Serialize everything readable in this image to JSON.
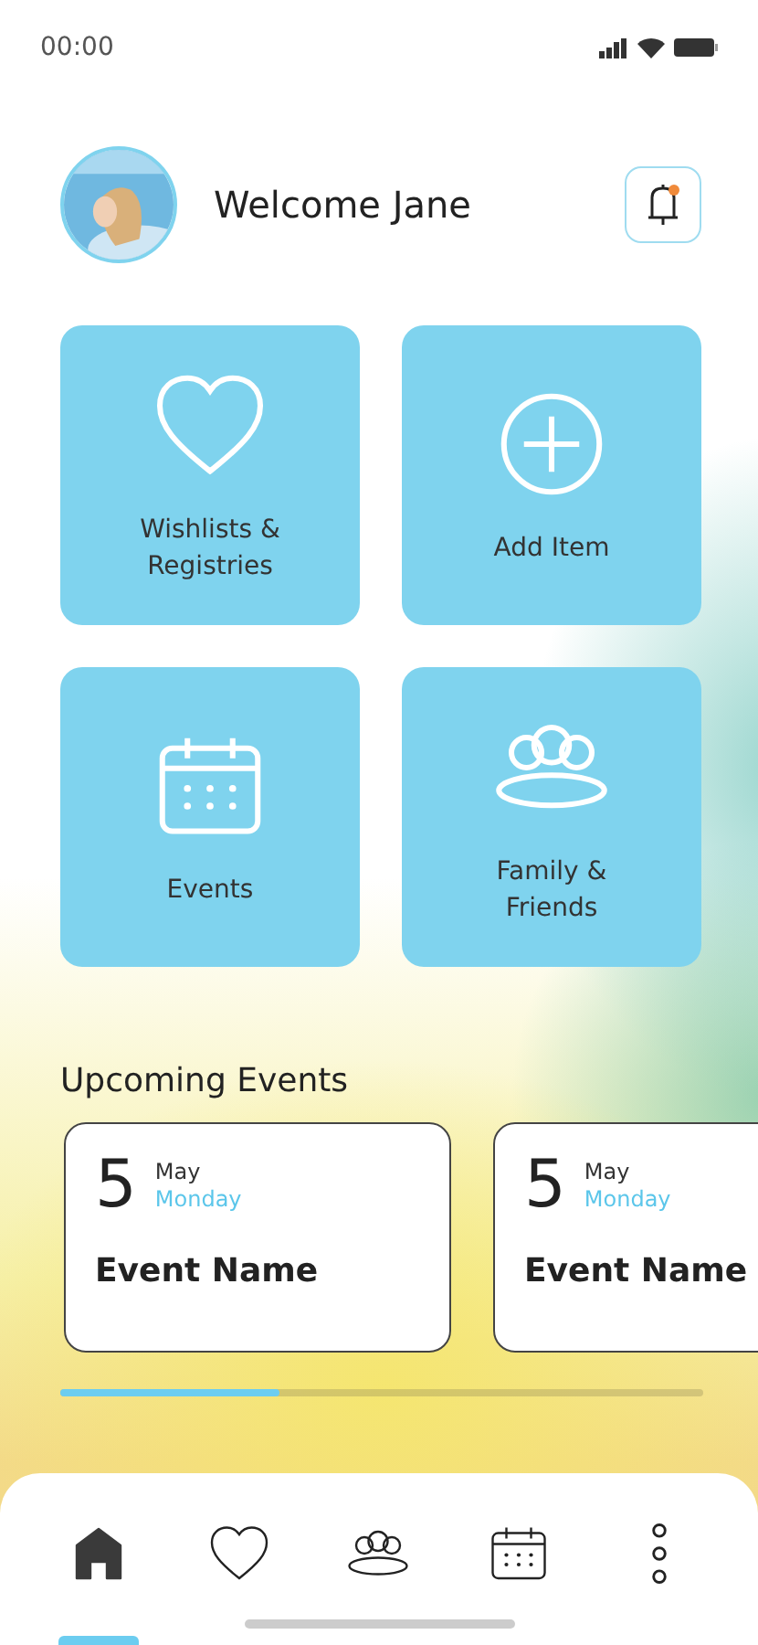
{
  "status_bar": {
    "time": "00:00"
  },
  "header": {
    "greeting": "Welcome Jane",
    "notification": {
      "unread": true
    }
  },
  "tiles": [
    {
      "kind": "heart",
      "label": "Wishlists & Registries"
    },
    {
      "kind": "plus",
      "label": "Add Item"
    },
    {
      "kind": "calendar",
      "label": "Events"
    },
    {
      "kind": "people",
      "label": "Family & Friends"
    }
  ],
  "upcoming": {
    "title": "Upcoming Events",
    "events": [
      {
        "day": "5",
        "month": "May",
        "weekday": "Monday",
        "name": "Event Name"
      },
      {
        "day": "5",
        "month": "May",
        "weekday": "Monday",
        "name": "Event Name"
      }
    ]
  },
  "nav": [
    {
      "kind": "home",
      "selected": true
    },
    {
      "kind": "heart",
      "selected": false
    },
    {
      "kind": "people",
      "selected": false
    },
    {
      "kind": "calendar",
      "selected": false
    },
    {
      "kind": "more",
      "selected": false
    }
  ]
}
